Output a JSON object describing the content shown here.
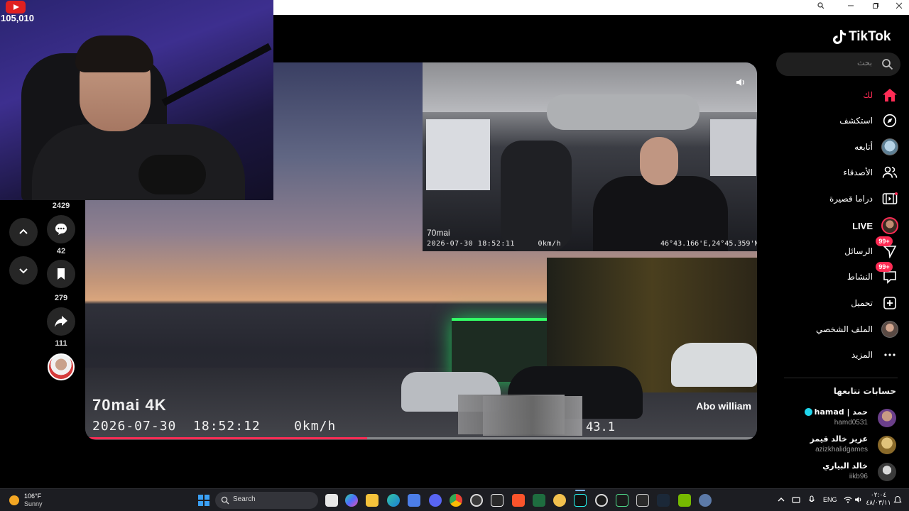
{
  "browser": {
    "window_controls": [
      "zoom-icon",
      "minimize-icon",
      "maximize-icon",
      "close-icon"
    ]
  },
  "stream": {
    "youtube_viewers": "105,010"
  },
  "video": {
    "dashcam_brand": "70mai 4K",
    "dashcam_timestamp": "2026-07-30  18:52:12    0km/h",
    "dashcam_coords": "43.1",
    "inset_brand": "70mai",
    "inset_timestamp": "2026-07-30 18:52:11     0km/h",
    "inset_coords": "46°43.166'E,24°45.359'N",
    "author": "Abo william",
    "progress_fraction": 0.42
  },
  "actions": {
    "likes": "2429",
    "comments": "42",
    "saves": "279",
    "shares": "111"
  },
  "sidebar": {
    "logo": "TikTok",
    "search_placeholder": "بحث",
    "items": [
      {
        "label": "لك",
        "icon": "home-icon",
        "active": true
      },
      {
        "label": "استكشف",
        "icon": "compass-icon"
      },
      {
        "label": "أتابعه",
        "icon": "following-avatar-icon"
      },
      {
        "label": "الأصدقاء",
        "icon": "friends-icon"
      },
      {
        "label": "دراما قصيرة",
        "icon": "short-drama-icon"
      },
      {
        "label": "LIVE",
        "icon": "live-avatar-icon"
      },
      {
        "label": "الرسائل",
        "icon": "messages-icon",
        "badge": "99+"
      },
      {
        "label": "النشاط",
        "icon": "activity-icon",
        "badge": "99+"
      },
      {
        "label": "تحميل",
        "icon": "upload-icon"
      },
      {
        "label": "الملف الشخصي",
        "icon": "profile-avatar-icon"
      },
      {
        "label": "المزيد",
        "icon": "more-icon"
      }
    ],
    "following_title": "حسابات تتابعها",
    "accounts": [
      {
        "name": "hamad | حمد",
        "handle": "hamd0531",
        "verified": true
      },
      {
        "name": "عزيز خالد قيمز",
        "handle": "azizkhalidgames",
        "verified": false
      },
      {
        "name": "خالد البياري",
        "handle": "iikb96",
        "verified": false
      }
    ]
  },
  "taskbar": {
    "weather_temp": "106°F",
    "weather_cond": "Sunny",
    "search_label": "Search",
    "language": "ENG",
    "time": "٠٢:٠٤",
    "date": "٤٨/٠٣/١١"
  },
  "colors": {
    "accent": "#fe2c55",
    "verified": "#20d5ec"
  }
}
